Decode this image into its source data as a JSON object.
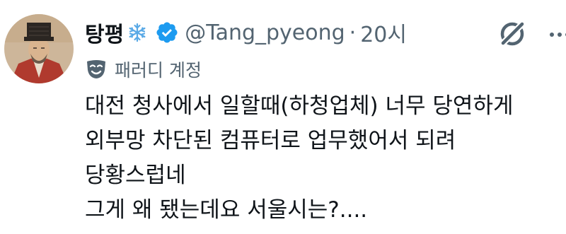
{
  "tweet": {
    "display_name": "탕평",
    "handle": "@Tang_pyeong",
    "separator": "·",
    "time": "20시",
    "account_label": "패러디 계정",
    "text_lines": [
      "대전 청사에서 일할때(하청업체) 너무 당연하게",
      "외부망 차단된 컴퓨터로 업무했어서 되려",
      "당황스럽네",
      "그게 왜 됐는데요 서울시는?...."
    ]
  },
  "icons": {
    "name_badge": "snowflake-icon",
    "verified": "verified-badge-icon",
    "grok": "grok-icon",
    "more": "more-icon",
    "parody": "parody-mask-icon"
  },
  "colors": {
    "verified_blue": "#1d9bf0",
    "snowflake": "#59a9e6",
    "secondary_text": "#536471",
    "primary_text": "#0f1419"
  }
}
